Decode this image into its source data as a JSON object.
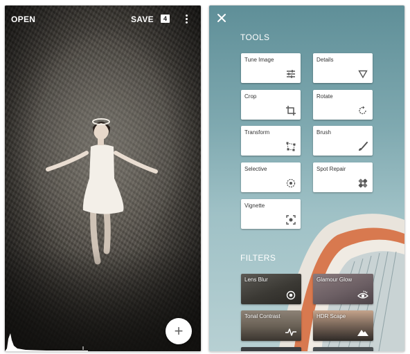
{
  "left_panel": {
    "topbar": {
      "open_label": "OPEN",
      "save_label": "SAVE",
      "layers_count": "4",
      "more_icon": "more-vert-icon"
    },
    "add_button_label": "+"
  },
  "right_panel": {
    "close_icon": "close-icon",
    "tools_title": "TOOLS",
    "tools": [
      {
        "label": "Tune Image",
        "icon": "tune-icon"
      },
      {
        "label": "Details",
        "icon": "triangle-down-icon"
      },
      {
        "label": "Crop",
        "icon": "crop-icon"
      },
      {
        "label": "Rotate",
        "icon": "rotate-icon"
      },
      {
        "label": "Transform",
        "icon": "transform-icon"
      },
      {
        "label": "Brush",
        "icon": "brush-icon"
      },
      {
        "label": "Selective",
        "icon": "selective-icon"
      },
      {
        "label": "Spot Repair",
        "icon": "bandage-icon"
      },
      {
        "label": "Vignette",
        "icon": "vignette-icon"
      }
    ],
    "filters_title": "FILTERS",
    "filters": [
      {
        "label": "Lens Blur",
        "icon": "lens-blur-icon"
      },
      {
        "label": "Glamour Glow",
        "icon": "eye-icon"
      },
      {
        "label": "Tonal Contrast",
        "icon": "pulse-icon"
      },
      {
        "label": "HDR Scape",
        "icon": "mountain-icon"
      }
    ]
  },
  "colors": {
    "panel_bg": "#1b1a17",
    "sky_top": "#5f8f98",
    "accent_orange": "#d8794f",
    "card_bg": "#ffffff"
  }
}
